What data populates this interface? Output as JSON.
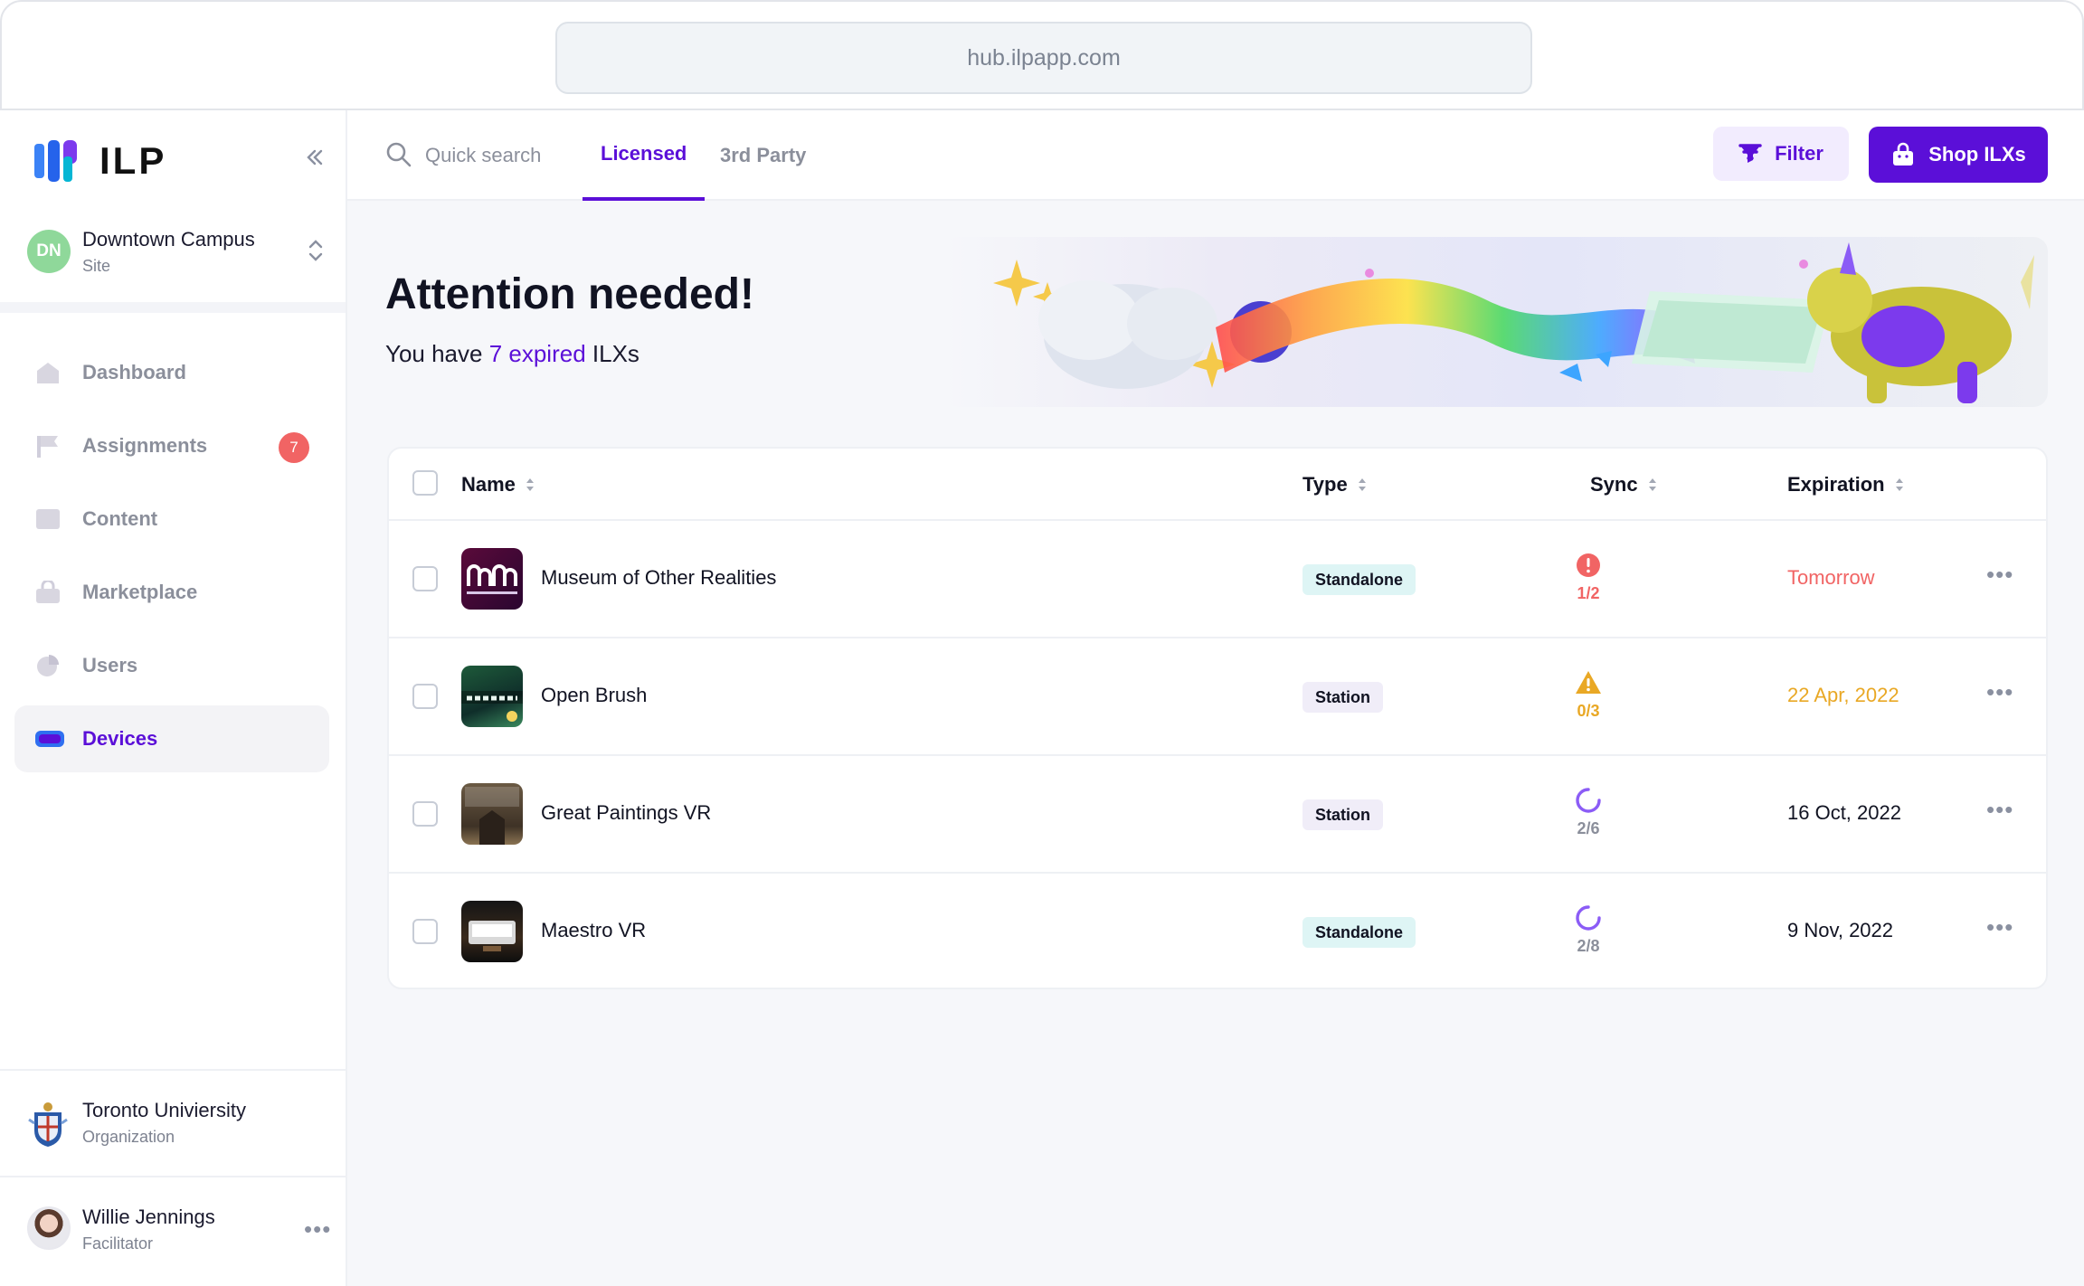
{
  "browser": {
    "url": "hub.ilpapp.com"
  },
  "brand": {
    "name": "ILP"
  },
  "site": {
    "initials": "DN",
    "name": "Downtown Campus",
    "role": "Site"
  },
  "nav": {
    "items": [
      {
        "label": "Dashboard",
        "icon": "home-icon"
      },
      {
        "label": "Assignments",
        "icon": "flag-icon",
        "badge": "7"
      },
      {
        "label": "Content",
        "icon": "folder-icon"
      },
      {
        "label": "Marketplace",
        "icon": "shopping-bag-icon"
      },
      {
        "label": "Users",
        "icon": "pie-chart-icon"
      },
      {
        "label": "Devices",
        "icon": "vr-headset-icon",
        "active": true
      }
    ]
  },
  "org": {
    "name": "Toronto Univiersity",
    "role": "Organization"
  },
  "user": {
    "name": "Willie Jennings",
    "role": "Facilitator"
  },
  "topbar": {
    "search_placeholder": "Quick search",
    "tabs": [
      {
        "label": "Licensed",
        "active": true
      },
      {
        "label": "3rd Party"
      }
    ],
    "filter_label": "Filter",
    "shop_label": "Shop ILXs"
  },
  "hero": {
    "title": "Attention needed!",
    "sub_prefix": "You have ",
    "sub_accent": "7 expired",
    "sub_suffix": " ILXs"
  },
  "table": {
    "columns": [
      "Name",
      "Type",
      "Sync",
      "Expiration"
    ],
    "rows": [
      {
        "name": "Museum of Other Realities",
        "type": "Standalone",
        "sync": "1/2",
        "sync_status": "error",
        "expiration": "Tomorrow",
        "exp_color": "#f16464"
      },
      {
        "name": "Open Brush",
        "type": "Station",
        "sync": "0/3",
        "sync_status": "warning",
        "expiration": "22 Apr, 2022",
        "exp_color": "#e9a825"
      },
      {
        "name": "Great Paintings VR",
        "type": "Station",
        "sync": "2/6",
        "sync_status": "syncing",
        "expiration": "16 Oct, 2022",
        "exp_color": "#111322"
      },
      {
        "name": "Maestro VR",
        "type": "Standalone",
        "sync": "2/8",
        "sync_status": "syncing",
        "expiration": "9 Nov, 2022",
        "exp_color": "#111322"
      }
    ]
  },
  "colors": {
    "accent": "#5b0fd8",
    "error": "#f16464",
    "warning": "#e9a825",
    "syncing": "#8b5cf6"
  }
}
